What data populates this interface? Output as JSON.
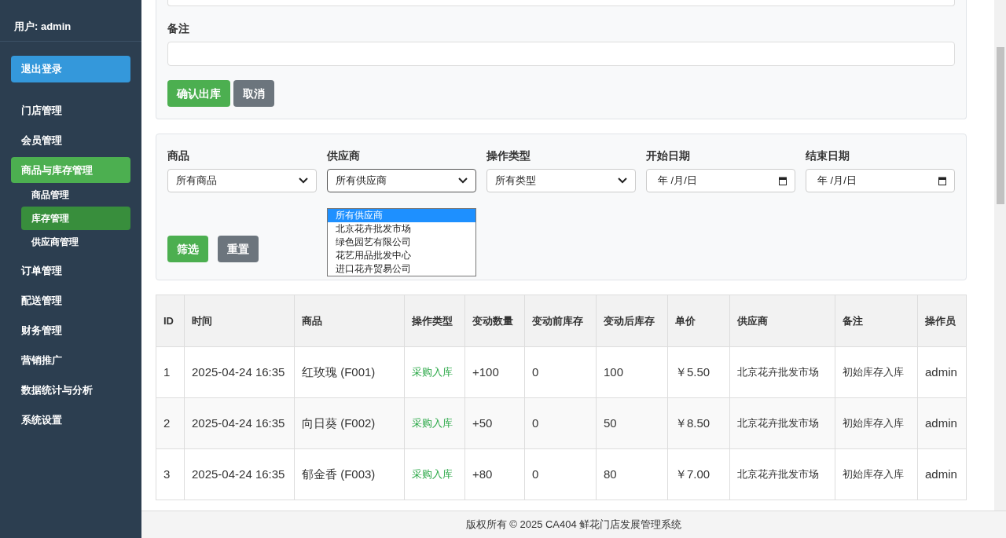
{
  "sidebar": {
    "user": "用户: admin",
    "logout": "退出登录",
    "items": [
      {
        "label": "门店管理",
        "selected": false
      },
      {
        "label": "会员管理",
        "selected": false
      },
      {
        "label": "商品与库存管理",
        "selected": true,
        "children": [
          {
            "label": "商品管理",
            "selected": false
          },
          {
            "label": "库存管理",
            "selected": true
          },
          {
            "label": "供应商管理",
            "selected": false
          }
        ]
      },
      {
        "label": "订单管理",
        "selected": false
      },
      {
        "label": "配送管理",
        "selected": false
      },
      {
        "label": "财务管理",
        "selected": false
      },
      {
        "label": "营销推广",
        "selected": false
      },
      {
        "label": "数据统计与分析",
        "selected": false
      },
      {
        "label": "系统设置",
        "selected": false
      }
    ]
  },
  "outbound_form": {
    "note_label": "备注",
    "buttons": [
      {
        "label": "确认出库",
        "kind": "primary"
      },
      {
        "label": "取消",
        "kind": "secondary"
      }
    ]
  },
  "filters": {
    "fields": [
      {
        "label": "商品",
        "kind": "select",
        "value": "所有商品"
      },
      {
        "label": "供应商",
        "kind": "select",
        "value": "所有供应商",
        "expanded": true,
        "options": [
          {
            "label": "所有供应商",
            "selected": true
          },
          {
            "label": "北京花卉批发市场",
            "selected": false
          },
          {
            "label": "绿色园艺有限公司",
            "selected": false
          },
          {
            "label": "花艺用品批发中心",
            "selected": false
          },
          {
            "label": "进口花卉贸易公司",
            "selected": false
          }
        ]
      },
      {
        "label": "操作类型",
        "kind": "select",
        "value": "所有类型"
      },
      {
        "label": "开始日期",
        "kind": "date",
        "value": "年 /月/日"
      },
      {
        "label": "结束日期",
        "kind": "date",
        "value": "年 /月/日"
      }
    ],
    "buttons": [
      {
        "label": "筛选",
        "kind": "primary"
      },
      {
        "label": "重置",
        "kind": "secondary"
      }
    ]
  },
  "table": {
    "columns": [
      "ID",
      "时间",
      "商品",
      "操作类型",
      "变动数量",
      "变动前库存",
      "变动后库存",
      "单价",
      "供应商",
      "备注",
      "操作员"
    ],
    "rows": [
      [
        "1",
        "2025-04-24 16:35",
        "红玫瑰 (F001)",
        "采购入库",
        "+100",
        "0",
        "100",
        "￥5.50",
        "北京花卉批发市场",
        "初始库存入库",
        "admin"
      ],
      [
        "2",
        "2025-04-24 16:35",
        "向日葵 (F002)",
        "采购入库",
        "+50",
        "0",
        "50",
        "￥8.50",
        "北京花卉批发市场",
        "初始库存入库",
        "admin"
      ],
      [
        "3",
        "2025-04-24 16:35",
        "郁金香 (F003)",
        "采购入库",
        "+80",
        "0",
        "80",
        "￥7.00",
        "北京花卉批发市场",
        "初始库存入库",
        "admin"
      ]
    ]
  },
  "footer": "版权所有 © 2025 CA404 鲜花门店发展管理系统"
}
